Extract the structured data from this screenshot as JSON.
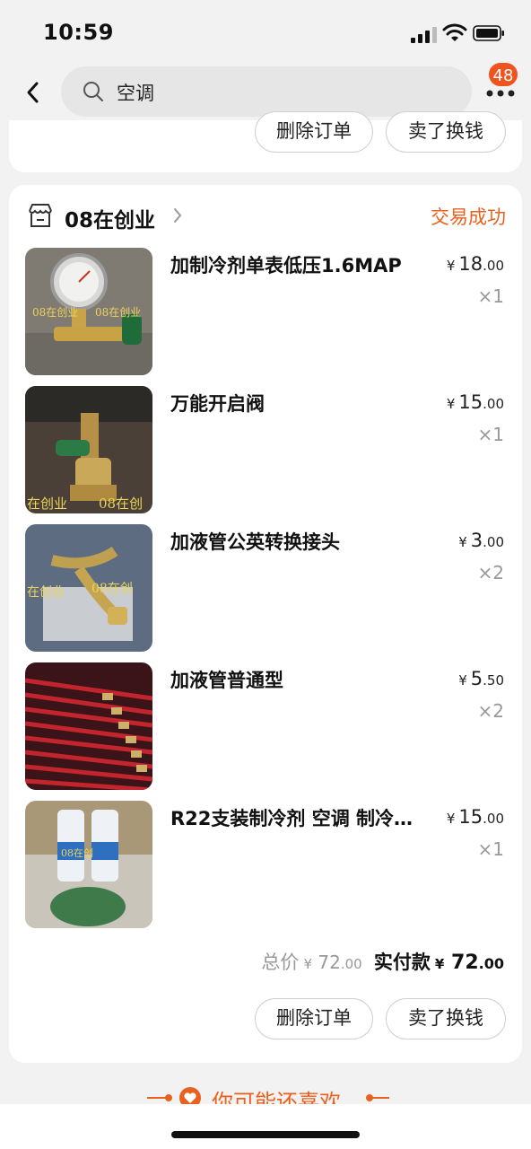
{
  "status_bar": {
    "time": "10:59"
  },
  "nav": {
    "search_query": "空调",
    "badge_count": "48"
  },
  "actions": {
    "delete_order": "删除订单",
    "sell_for_cash": "卖了换钱"
  },
  "order": {
    "shop_name": "08在创业",
    "status": "交易成功",
    "items": [
      {
        "name": "加制冷剂单表低压1.6MAP",
        "currency": "¥",
        "price_int": "18",
        "price_dec": ".00",
        "qty": "×1",
        "thumb": "pressure-gauge"
      },
      {
        "name": "万能开启阀",
        "currency": "¥",
        "price_int": "15",
        "price_dec": ".00",
        "qty": "×1",
        "thumb": "valve"
      },
      {
        "name": "加液管公英转换接头",
        "currency": "¥",
        "price_int": "3",
        "price_dec": ".00",
        "qty": "×2",
        "thumb": "adapter"
      },
      {
        "name": "加液管普通型",
        "currency": "¥",
        "price_int": "5",
        "price_dec": ".50",
        "qty": "×2",
        "thumb": "red-hoses"
      },
      {
        "name": "R22支装制冷剂 空调 制冷…",
        "currency": "¥",
        "price_int": "15",
        "price_dec": ".00",
        "qty": "×1",
        "thumb": "refrigerant-cans"
      }
    ],
    "total_label": "总价",
    "total_currency": "¥",
    "total_int": "72",
    "total_dec": ".00",
    "paid_label": "实付款",
    "paid_currency": "¥",
    "paid_int": "72",
    "paid_dec": ".00"
  },
  "recommend": {
    "title": "你可能还喜欢"
  },
  "colors": {
    "accent": "#e8621f",
    "badge": "#f0541e",
    "page_bg": "#f2f2f2"
  }
}
